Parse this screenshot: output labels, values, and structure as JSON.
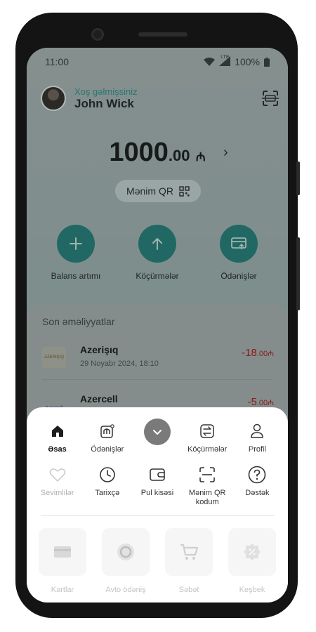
{
  "status_bar": {
    "time": "11:00",
    "network": "LTE",
    "battery": "100%"
  },
  "header": {
    "greeting": "Xoş gəlmişsiniz",
    "user_name": "John Wick"
  },
  "balance": {
    "integer": "1000",
    "decimal": ".00",
    "currency": "₼"
  },
  "my_qr": {
    "label": "Mənim QR"
  },
  "quick_actions": [
    {
      "label": "Balans artımı",
      "icon": "plus-icon"
    },
    {
      "label": "Köçürmələr",
      "icon": "arrow-up-icon"
    },
    {
      "label": "Ödənişlər",
      "icon": "card-icon"
    }
  ],
  "transactions": {
    "title": "Son əməliyyatlar",
    "items": [
      {
        "name": "Azerişıq",
        "date": "29 Noyabr 2024, 18:10",
        "amount_int": "-18",
        "amount_dec": ".00₼",
        "logo_text": "AZERIŞIQ"
      },
      {
        "name": "Azercell",
        "date": "",
        "amount_int": "-5",
        "amount_dec": ".00₼",
        "logo_text": "Azercell"
      }
    ]
  },
  "menu": {
    "row1": [
      {
        "label": "Əsas",
        "icon": "home-icon",
        "active": true
      },
      {
        "label": "Ödənişlər",
        "icon": "payments-icon"
      },
      {
        "label": "",
        "icon": "chevron-down-icon"
      },
      {
        "label": "Köçürmələr",
        "icon": "transfer-icon"
      },
      {
        "label": "Profil",
        "icon": "profile-icon"
      }
    ],
    "row2": [
      {
        "label": "Sevimlilər",
        "icon": "heart-icon",
        "disabled": true
      },
      {
        "label": "Tarixçə",
        "icon": "clock-icon"
      },
      {
        "label": "Pul kisəsi",
        "icon": "wallet-icon"
      },
      {
        "label": "Mənim QR kodum",
        "icon": "qr-scan-icon"
      },
      {
        "label": "Dəstək",
        "icon": "help-icon"
      }
    ],
    "row3": [
      {
        "label": "Kartlar",
        "icon": "credit-card-icon"
      },
      {
        "label": "Avto ödəniş",
        "icon": "auto-pay-icon"
      },
      {
        "label": "Səbət",
        "icon": "cart-icon"
      },
      {
        "label": "Keşbek",
        "icon": "cashback-icon"
      }
    ]
  },
  "colors": {
    "accent": "#1f7d78",
    "negative": "#b01313"
  }
}
